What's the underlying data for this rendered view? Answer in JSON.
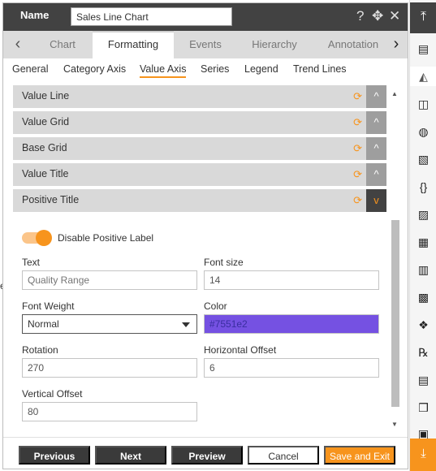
{
  "header": {
    "name_label": "Name",
    "name_value": "Sales Line Chart",
    "help_icon": "?",
    "move_icon": "✥",
    "close_icon": "✕"
  },
  "tabs": {
    "prev_arrow": "‹",
    "next_arrow": "›",
    "items": [
      {
        "label": "Chart"
      },
      {
        "label": "Formatting"
      },
      {
        "label": "Events"
      },
      {
        "label": "Hierarchy"
      },
      {
        "label": "Annotation"
      }
    ],
    "active": "Formatting"
  },
  "subtabs": {
    "items": [
      {
        "label": "General"
      },
      {
        "label": "Category Axis"
      },
      {
        "label": "Value Axis"
      },
      {
        "label": "Series"
      },
      {
        "label": "Legend"
      },
      {
        "label": "Trend Lines"
      }
    ],
    "active": "Value Axis"
  },
  "accordions": [
    {
      "title": "Value Line",
      "toggle": "^"
    },
    {
      "title": "Value Grid",
      "toggle": "^"
    },
    {
      "title": "Base Grid",
      "toggle": "^"
    },
    {
      "title": "Value Title",
      "toggle": "^"
    },
    {
      "title": "Positive Title",
      "toggle": "v"
    }
  ],
  "reset_icon": "⟳",
  "form": {
    "disable_label": "Disable Positive Label",
    "text_label": "Text",
    "text_placeholder": "Quality Range",
    "font_size_label": "Font size",
    "font_size_value": "14",
    "font_weight_label": "Font Weight",
    "font_weight_value": "Normal",
    "color_label": "Color",
    "color_value": "#7551e2",
    "rotation_label": "Rotation",
    "rotation_value": "270",
    "h_offset_label": "Horizontal Offset",
    "h_offset_value": "6",
    "v_offset_label": "Vertical Offset",
    "v_offset_value": "80"
  },
  "footer": {
    "previous": "Previous",
    "next": "Next",
    "preview": "Preview",
    "cancel": "Cancel",
    "save_exit": "Save and Exit"
  },
  "right_bar": {
    "top_icon": "⤒",
    "bottom_icon": "⤓",
    "icons": [
      "▤",
      "◭",
      "◫",
      "◍",
      "▧",
      "{}",
      "▨",
      "▦",
      "▥",
      "▩",
      "❖",
      "℞",
      "▤",
      "❒",
      "▣"
    ]
  },
  "left_glyph": "e",
  "colors": {
    "accent": "#f7941d",
    "header_bg": "#424242",
    "color_swatch": "#7551e2"
  }
}
